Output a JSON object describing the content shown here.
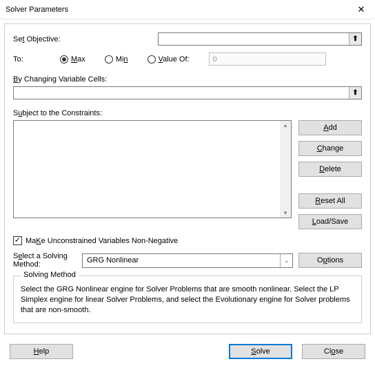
{
  "window": {
    "title": "Solver Parameters",
    "close_glyph": "✕"
  },
  "labels": {
    "set_objective_pre": "Se",
    "set_objective_u": "t",
    "set_objective_post": " Objective:",
    "to": "To:",
    "max_u": "M",
    "max_post": "ax",
    "min_pre": "Mi",
    "min_u": "n",
    "value_u": "V",
    "value_post": "alue Of:",
    "by_u": "B",
    "by_post": "y Changing Variable Cells:",
    "subject_pre": "S",
    "subject_u": "u",
    "subject_post": "bject to the Constraints:",
    "make_u": "K",
    "make_pre": "Ma",
    "make_post": "e Unconstrained Variables Non-Negative",
    "select_pre": "S",
    "select_u": "e",
    "select_post": "lect a Solving Method:",
    "solving_method": "Solving Method",
    "description": "Select the GRG Nonlinear engine for Solver Problems that are smooth nonlinear. Select the LP Simplex engine for linear Solver Problems, and select the Evolutionary engine for Solver problems that are non-smooth."
  },
  "values": {
    "objective": "",
    "value_of": "0",
    "changing_cells": "",
    "method": "GRG Nonlinear"
  },
  "buttons": {
    "add_u": "A",
    "add_post": "dd",
    "change_u": "C",
    "change_post": "hange",
    "delete_u": "D",
    "delete_post": "elete",
    "reset_u": "R",
    "reset_post": "eset All",
    "load_u": "L",
    "load_post": "oad/Save",
    "options_pre": "O",
    "options_u": "p",
    "options_post": "tions",
    "help_u": "H",
    "help_post": "elp",
    "solve_u": "S",
    "solve_post": "olve",
    "close_pre": "Cl",
    "close_u": "o",
    "close_post": "se"
  },
  "glyphs": {
    "ref_arrow": "⬆",
    "scroll_up": "▲",
    "scroll_down": "▼",
    "dropdown": "⌄",
    "check": "✓"
  }
}
